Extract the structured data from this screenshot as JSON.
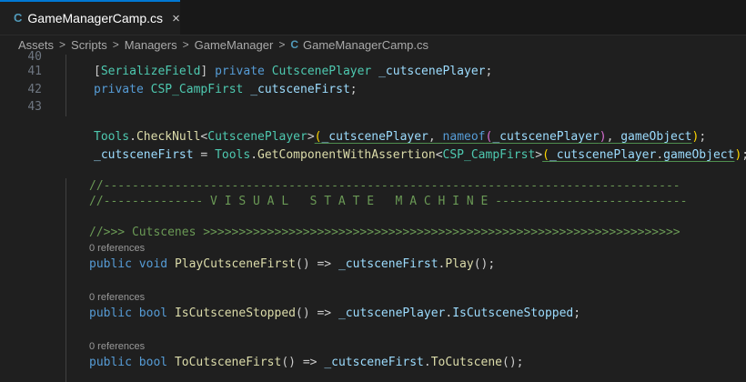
{
  "tab": {
    "label": "GameManagerCamp.cs",
    "icon": "csharp-file-icon",
    "close": "×"
  },
  "breadcrumb": {
    "items": [
      "Assets",
      "Scripts",
      "Managers",
      "GameManager"
    ],
    "file": "GameManagerCamp.cs",
    "separator": ">"
  },
  "gutter": {
    "lines": [
      "40",
      "41",
      "42",
      "43"
    ]
  },
  "code": {
    "l41": {
      "open": "[",
      "attr": "SerializeField",
      "close": "]",
      "kw": "private",
      "type": "CutscenePlayer",
      "id": "_cutscenePlayer",
      "end": ";"
    },
    "l42": {
      "kw": "private",
      "type": "CSP_CampFirst",
      "id": "_cutsceneFirst",
      "end": ";"
    },
    "l43": {
      "cls": "Tools",
      "dot": ".",
      "fn": "CheckNull",
      "lt": "<",
      "type": "CutscenePlayer",
      "gt": ">",
      "p1": "(",
      "arg1": "_cutscenePlayer",
      "comma1": ", ",
      "nameof": "nameof",
      "p2": "(",
      "arg2": "_cutscenePlayer",
      "p2c": ")",
      "comma2": ", ",
      "arg3": "gameObject",
      "p1c": ")",
      "end": ";"
    },
    "l44": {
      "id": "_cutsceneFirst",
      "eq": " = ",
      "cls": "Tools",
      "dot": ".",
      "fn": "GetComponentWithAssertion",
      "lt": "<",
      "type": "CSP_CampFirst",
      "gt": ">",
      "p1": "(",
      "arg": "_cutscenePlayer",
      "dot2": ".",
      "prop": "gameObject",
      "p1c": ")",
      "end": ";"
    },
    "comment1": "//---------------------------------------------------------------------------------",
    "comment2": "//-------------- V I S U A L   S T A T E   M A C H I N E ---------------------------",
    "comment3": "//>>> Cutscenes >>>>>>>>>>>>>>>>>>>>>>>>>>>>>>>>>>>>>>>>>>>>>>>>>>>>>>>>>>>>>>>>>>>",
    "lens": "0 references",
    "m1": {
      "mod": "public",
      "ret": "void",
      "name": "PlayCutsceneFirst",
      "parens": "()",
      "arrow": " => ",
      "obj": "_cutsceneFirst",
      "dot": ".",
      "call": "Play",
      "args": "()",
      "end": ";"
    },
    "m2": {
      "mod": "public",
      "ret": "bool",
      "name": "IsCutsceneStopped",
      "parens": "()",
      "arrow": " => ",
      "obj": "_cutscenePlayer",
      "dot": ".",
      "call": "IsCutsceneStopped",
      "end": ";"
    },
    "m3": {
      "mod": "public",
      "ret": "bool",
      "name": "ToCutsceneFirst",
      "parens": "()",
      "arrow": " => ",
      "obj": "_cutsceneFirst",
      "dot": ".",
      "call": "ToCutscene",
      "args": "()",
      "end": ";"
    }
  }
}
